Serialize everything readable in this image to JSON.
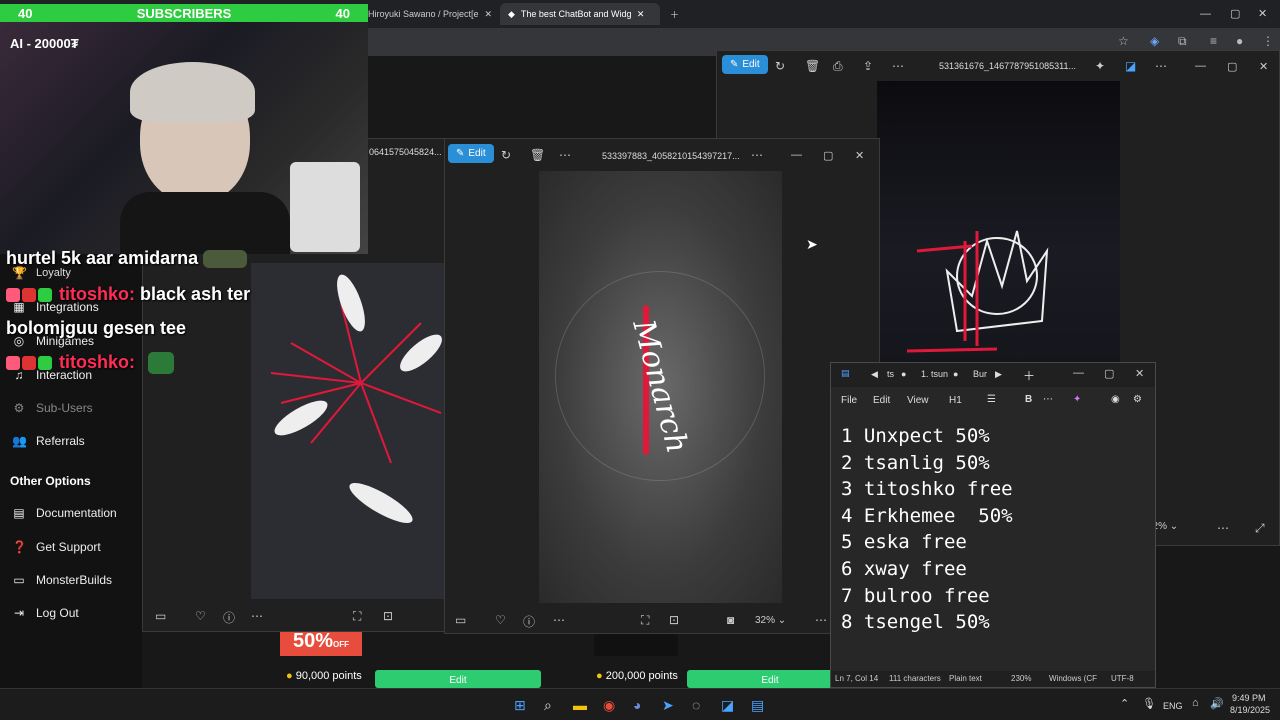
{
  "stream_overlay": {
    "subscribers_left": "40",
    "subscribers_label": "SUBSCRIBERS",
    "subscribers_right": "40",
    "ai_counter": "AI - 20000₮",
    "chat": [
      {
        "text": "hurtel 5k aar amidarna"
      },
      {
        "user": "titoshko:",
        "message": "black ash ter"
      },
      {
        "text": "bolomjguu gesen tee"
      },
      {
        "user": "titoshko:",
        "message": ""
      }
    ]
  },
  "browser": {
    "tabs": [
      {
        "label": "Hiroyuki Sawano / Project[emU]"
      },
      {
        "label": "The best ChatBot and Widgets"
      }
    ]
  },
  "sidebar": {
    "items": [
      {
        "label": "Loyalty",
        "icon": "trophy-icon"
      },
      {
        "label": "Integrations",
        "icon": "integrations-icon"
      },
      {
        "label": "Minigames",
        "icon": "gamepad-icon"
      },
      {
        "label": "Interaction",
        "icon": "music-icon"
      },
      {
        "label": "Sub-Users",
        "icon": "users-icon"
      },
      {
        "label": "Referrals",
        "icon": "referrals-icon"
      }
    ],
    "section_title": "Other Options",
    "options": [
      {
        "label": "Documentation",
        "icon": "doc-icon"
      },
      {
        "label": "Get Support",
        "icon": "help-icon"
      },
      {
        "label": "MonsterBuilds",
        "icon": "monitor-icon"
      },
      {
        "label": "Log Out",
        "icon": "logout-icon"
      }
    ]
  },
  "viewer_back": {
    "edit_label": "Edit",
    "filename": "531361676_1467787951085311...",
    "zoom": "32%"
  },
  "viewer_left": {
    "filename": "0641575045824..."
  },
  "viewer_front": {
    "edit_label": "Edit",
    "filename": "533397883_4058210154397217...",
    "zoom": "32%",
    "image_text": "Monarch"
  },
  "shop": {
    "card1_badge": "50%",
    "card1_badge_sub": "OFF",
    "card1_points": "90,000 points",
    "card2_points": "200,000 points",
    "edit_label": "Edit"
  },
  "notepad": {
    "tabs": [
      "ts",
      "1. tsun",
      "Bur"
    ],
    "menu": [
      "File",
      "Edit",
      "View",
      "H1"
    ],
    "lines": [
      "1 Unxpect 50%",
      "2 tsanlig 50%",
      "3 titoshko free",
      "4 Erkhemee  50%",
      "5 eska free",
      "6 xway free",
      "7 bulroo free",
      "8 tsengel 50%"
    ],
    "status": {
      "position": "Ln 7, Col 14",
      "chars": "111 characters",
      "format": "Plain text",
      "zoom": "230%",
      "eol": "Windows (CF",
      "encoding": "UTF-8"
    }
  },
  "taskbar": {
    "lang": "ENG",
    "time": "9:49 PM",
    "date": "8/19/2025"
  }
}
